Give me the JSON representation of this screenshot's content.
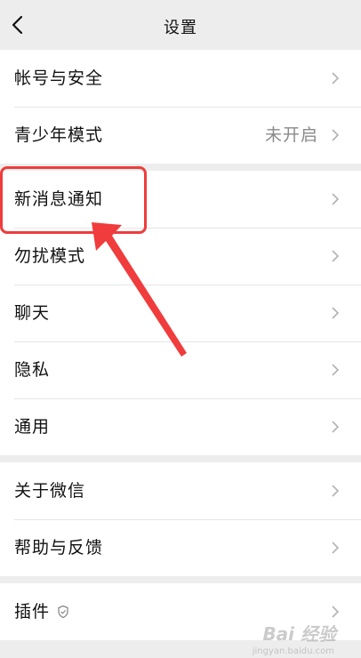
{
  "nav": {
    "title": "设置",
    "back_icon": "chevron-left-icon"
  },
  "groups": [
    {
      "rows": [
        {
          "label": "帐号与安全",
          "value": ""
        },
        {
          "label": "青少年模式",
          "value": "未开启"
        }
      ]
    },
    {
      "rows": [
        {
          "label": "新消息通知",
          "value": ""
        },
        {
          "label": "勿扰模式",
          "value": ""
        },
        {
          "label": "聊天",
          "value": ""
        },
        {
          "label": "隐私",
          "value": ""
        },
        {
          "label": "通用",
          "value": ""
        }
      ]
    },
    {
      "rows": [
        {
          "label": "关于微信",
          "value": ""
        },
        {
          "label": "帮助与反馈",
          "value": ""
        }
      ]
    },
    {
      "rows": [
        {
          "label": "插件",
          "value": ""
        }
      ]
    }
  ],
  "annotation": {
    "highlighted_item": "新消息通知",
    "color": "#f03c3c"
  },
  "watermark": {
    "text": "Bai 经验",
    "sub": "jingyan.baidu.com"
  },
  "colors": {
    "background": "#ededed",
    "row_background": "#ffffff",
    "text": "#111111",
    "secondary_text": "#8a8a8a",
    "chevron": "#b2b2b2"
  }
}
